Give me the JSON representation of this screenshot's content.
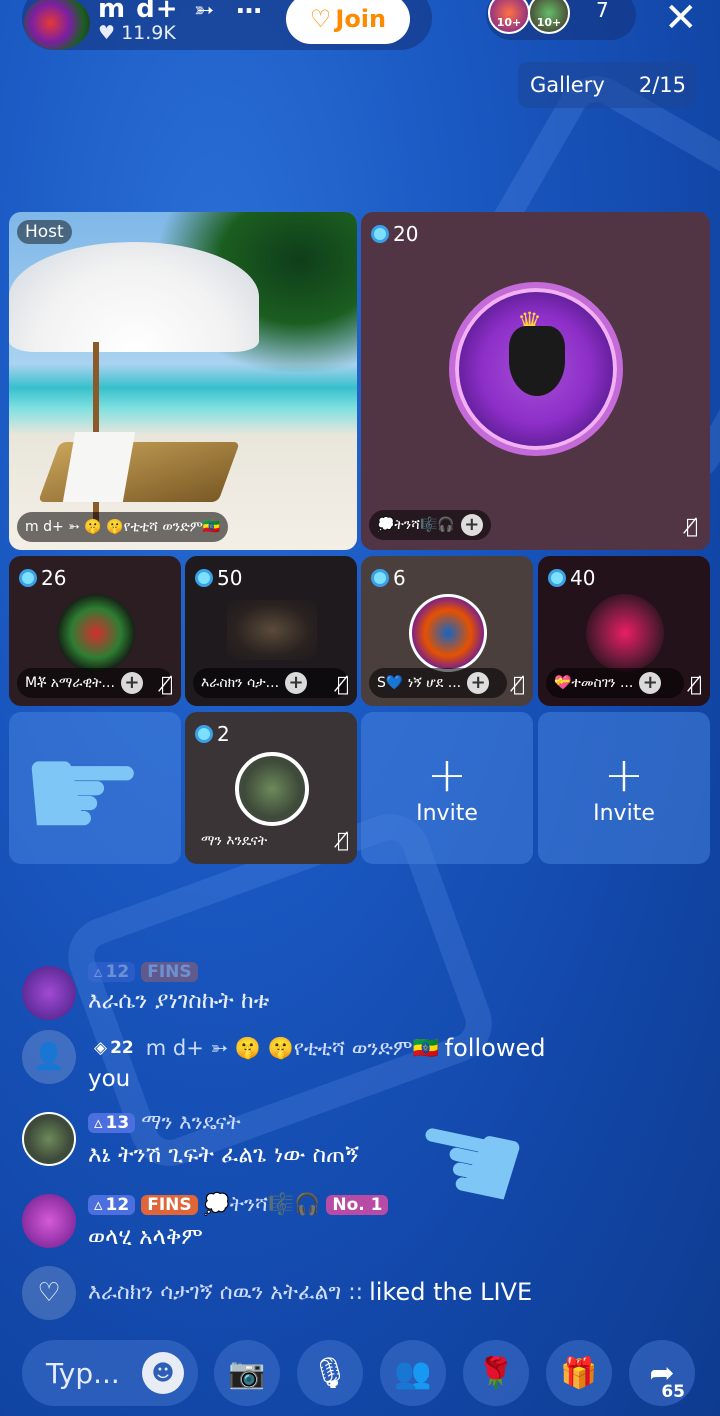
{
  "host": {
    "name": "m d+",
    "likes": "11.9K",
    "join_label": "Join"
  },
  "viewers": {
    "badges": [
      "10+",
      "10+"
    ],
    "count": "7"
  },
  "gallery": {
    "label": "Gallery",
    "page": "2/15"
  },
  "seats": {
    "host_tag": "Host",
    "host_plate": "m d+  ➳ 🤫 🤫የቲቲሻ ወንድም🇪🇹",
    "seat2": {
      "points": "20",
      "name": "💭ትንሻ🎼🎧"
    },
    "small": [
      {
        "points": "26",
        "name": "Mቾ አማራዊት..."
      },
      {
        "points": "50",
        "name": "እራስክን ሳታ..."
      },
      {
        "points": "6",
        "name": "S💙 ነኝ ሆደ ..."
      },
      {
        "points": "40",
        "name": "💝ተመስገን ..."
      }
    ],
    "seat7": {
      "points": "2",
      "name": "ማን እንዴናት"
    },
    "invite_label": "Invite"
  },
  "chat": [
    {
      "level": "12",
      "fins": "FINS",
      "text": "እራሴን ያነገስኩት ከቱ"
    },
    {
      "level": "22",
      "user": "m d+  ➳ 🤫 🤫የቲቲሻ ወንድም🇪🇹",
      "action": "followed",
      "action2": "you"
    },
    {
      "level": "13",
      "user": "ማን እንዴናት",
      "text": "እኔ ትንሽ ጊፍት ፈልጌ ነው ስጠኝ"
    },
    {
      "level": "12",
      "fins": "FINS",
      "user": "💭ትንሻ🎼🎧",
      "rank": "No. 1",
      "text": "ወላሂ አላቅም"
    },
    {
      "user": "እራስክን ሳታገኝ ሰዉን አትፈልግ ::",
      "action": "liked the LIVE"
    }
  ],
  "bottom": {
    "placeholder": "Typ...",
    "share_count": "65"
  },
  "colors": {
    "accent": "#1a58c2",
    "join": "#ff8a00",
    "level": "#4c6fe0",
    "fins": "#e0663a"
  }
}
